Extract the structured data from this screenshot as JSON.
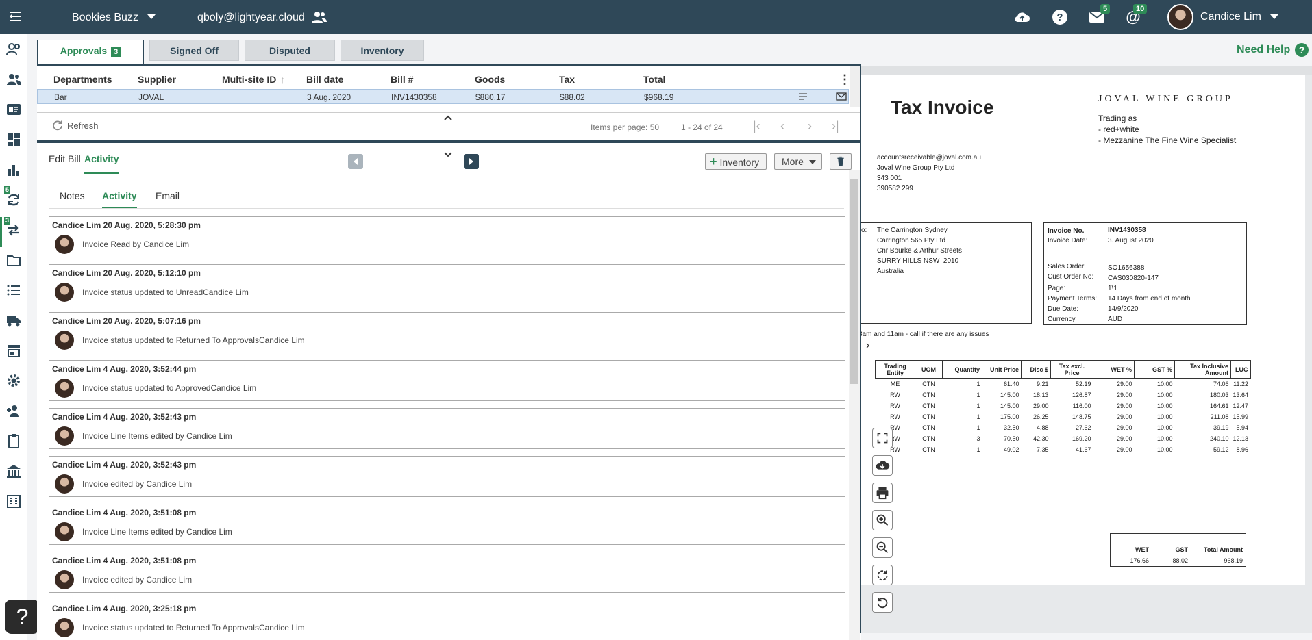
{
  "topbar": {
    "org_name": "Bookies Buzz",
    "user_email": "qboly@lightyear.cloud",
    "mail_badge": "5",
    "mentions_badge": "10",
    "user_name": "Candice Lim"
  },
  "sidebar": {
    "sync_badge": "5",
    "transfer_badge": "3",
    "help_glyph": "?"
  },
  "tabs": [
    {
      "label": "Approvals",
      "badge": "3"
    },
    {
      "label": "Signed Off"
    },
    {
      "label": "Disputed"
    },
    {
      "label": "Inventory"
    }
  ],
  "need_help": "Need Help",
  "grid": {
    "columns": [
      "Departments",
      "Supplier",
      "Multi-site ID",
      "Bill date",
      "Bill #",
      "Goods",
      "Tax",
      "Total"
    ],
    "rows": [
      {
        "department": "Bar",
        "supplier": "JOVAL",
        "multisite": "",
        "bill_date": "3 Aug. 2020",
        "bill_no": "INV1430358",
        "goods": "$880.17",
        "tax": "$88.02",
        "total": "$968.19"
      }
    ],
    "refresh_label": "Refresh",
    "items_per_page_label": "Items per page: 50",
    "range_label": "1 - 24 of 24"
  },
  "detail": {
    "tabs": [
      "Edit Bill",
      "Activity"
    ],
    "inventory_button": "Inventory",
    "more_button": "More",
    "subtabs": [
      "Notes",
      "Activity",
      "Email"
    ]
  },
  "activity": [
    {
      "title": "Candice Lim 20 Aug. 2020, 5:28:30 pm",
      "text": "Invoice Read by Candice Lim"
    },
    {
      "title": "Candice Lim 20 Aug. 2020, 5:12:10 pm",
      "text": "Invoice status updated to UnreadCandice Lim"
    },
    {
      "title": "Candice Lim 20 Aug. 2020, 5:07:16 pm",
      "text": "Invoice status updated to Returned To ApprovalsCandice Lim"
    },
    {
      "title": "Candice Lim 4 Aug. 2020, 3:52:44 pm",
      "text": "Invoice status updated to ApprovedCandice Lim"
    },
    {
      "title": "Candice Lim 4 Aug. 2020, 3:52:43 pm",
      "text": "Invoice Line Items edited by Candice Lim"
    },
    {
      "title": "Candice Lim 4 Aug. 2020, 3:52:43 pm",
      "text": "Invoice edited by Candice Lim"
    },
    {
      "title": "Candice Lim 4 Aug. 2020, 3:51:08 pm",
      "text": "Invoice Line Items edited by Candice Lim"
    },
    {
      "title": "Candice Lim 4 Aug. 2020, 3:51:08 pm",
      "text": "Invoice edited by Candice Lim"
    },
    {
      "title": "Candice Lim 4 Aug. 2020, 3:25:18 pm",
      "text": "Invoice status updated to Returned To ApprovalsCandice Lim"
    }
  ],
  "invoice": {
    "title": "Tax Invoice",
    "company": "JOVAL WINE GROUP",
    "trading_as": "Trading as",
    "brand1": "- red+white",
    "brand2": "- Mezzanine The Fine Wine Specialist",
    "supplier_lines": [
      "accountsreceivable@joval.com.au",
      "Joval Wine Group Pty Ltd",
      "343 001",
      "390582 299"
    ],
    "to_prefix": "o:",
    "to_lines": [
      "The Carrington Sydney",
      "Carrington 565 Pty Ltd",
      "Cnr Bourke & Arthur Streets",
      "SURRY HILLS NSW  2010",
      "Australia"
    ],
    "meta": [
      {
        "k": "Invoice No.",
        "v": "INV1430358"
      },
      {
        "k": "Invoice Date:",
        "v": "3. August 2020"
      },
      {
        "k": "",
        "v": ""
      },
      {
        "k": "Sales Order",
        "v": "SO1656388"
      },
      {
        "k": "Cust Order No:",
        "v": "CAS030820-147"
      },
      {
        "k": "Page:",
        "v": "1\\1"
      },
      {
        "k": "Payment Terms:",
        "v": "14 Days from end of month"
      },
      {
        "k": "Due Date:",
        "v": "14/9/2020"
      },
      {
        "k": "Currency",
        "v": "AUD"
      }
    ],
    "note": "8am and 11am - call if there are any issues",
    "line_headers": [
      "Trading Entity",
      "UOM",
      "Quantity",
      "Unit Price",
      "Disc $",
      "Tax excl. Price",
      "WET %",
      "GST %",
      "Tax Inclusive Amount",
      "LUC"
    ],
    "lines": [
      [
        "ME",
        "CTN",
        "1",
        "61.40",
        "9.21",
        "52.19",
        "29.00",
        "10.00",
        "74.06",
        "11.22"
      ],
      [
        "RW",
        "CTN",
        "1",
        "145.00",
        "18.13",
        "126.87",
        "29.00",
        "10.00",
        "180.03",
        "13.64"
      ],
      [
        "RW",
        "CTN",
        "1",
        "145.00",
        "29.00",
        "116.00",
        "29.00",
        "10.00",
        "164.61",
        "12.47"
      ],
      [
        "RW",
        "CTN",
        "1",
        "175.00",
        "26.25",
        "148.75",
        "29.00",
        "10.00",
        "211.08",
        "15.99"
      ],
      [
        "RW",
        "CTN",
        "1",
        "32.50",
        "4.88",
        "27.62",
        "29.00",
        "10.00",
        "39.19",
        "5.94"
      ],
      [
        "RW",
        "CTN",
        "3",
        "70.50",
        "42.30",
        "169.20",
        "29.00",
        "10.00",
        "240.10",
        "12.13"
      ],
      [
        "RW",
        "CTN",
        "1",
        "49.02",
        "7.35",
        "41.67",
        "29.00",
        "10.00",
        "59.12",
        "8.96"
      ]
    ],
    "totals_headers": [
      "WET",
      "GST",
      "Total Amount"
    ],
    "totals_values": [
      "176.66",
      "88.02",
      "968.19"
    ]
  },
  "colors": {
    "topbar": "#2f4858",
    "accent": "#2e8b57",
    "selected_row": "#d8e6f5"
  }
}
